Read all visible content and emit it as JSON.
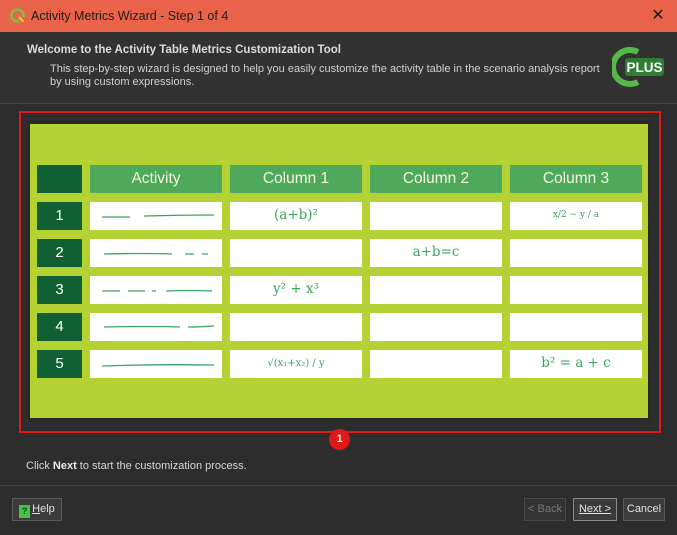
{
  "window": {
    "title": "Activity Metrics Wizard - Step 1 of 4",
    "close_glyph": "✕"
  },
  "header": {
    "title": "Welcome to the Activity Table Metrics Customization Tool",
    "description": "This step-by-step wizard is designed to help you easily customize the activity table in the scenario analysis report by using custom expressions.",
    "logo_text": "PLUS"
  },
  "illustration": {
    "columns": [
      "Activity",
      "Column 1",
      "Column 2",
      "Column 3"
    ],
    "rows": [
      {
        "number": "1",
        "col1": "(a+b)²",
        "col2": "",
        "col3": "x/2 − y / a"
      },
      {
        "number": "2",
        "col1": "",
        "col2": "a+b=c",
        "col3": ""
      },
      {
        "number": "3",
        "col1": "y² + x³",
        "col2": "",
        "col3": ""
      },
      {
        "number": "4",
        "col1": "",
        "col2": "",
        "col3": ""
      },
      {
        "number": "5",
        "col1": "√(x₁+x₂) / y",
        "col2": "",
        "col3": "b² = a + c"
      }
    ]
  },
  "callout_badge": "1",
  "footer": {
    "prefix": "Click ",
    "bold": "Next",
    "suffix": " to start the customization process."
  },
  "buttons": {
    "help_mn": "H",
    "help_rest": "elp",
    "back_mn": "< B",
    "back_rest": "ack",
    "next": "Next >",
    "cancel": "Cancel"
  },
  "colors": {
    "titlebar": "#e9634a",
    "board_green": "#b4d233",
    "header_green": "#4ea95a",
    "number_green": "#116033",
    "handwriting_green": "#3ea45c",
    "callout_red": "#e01818"
  }
}
